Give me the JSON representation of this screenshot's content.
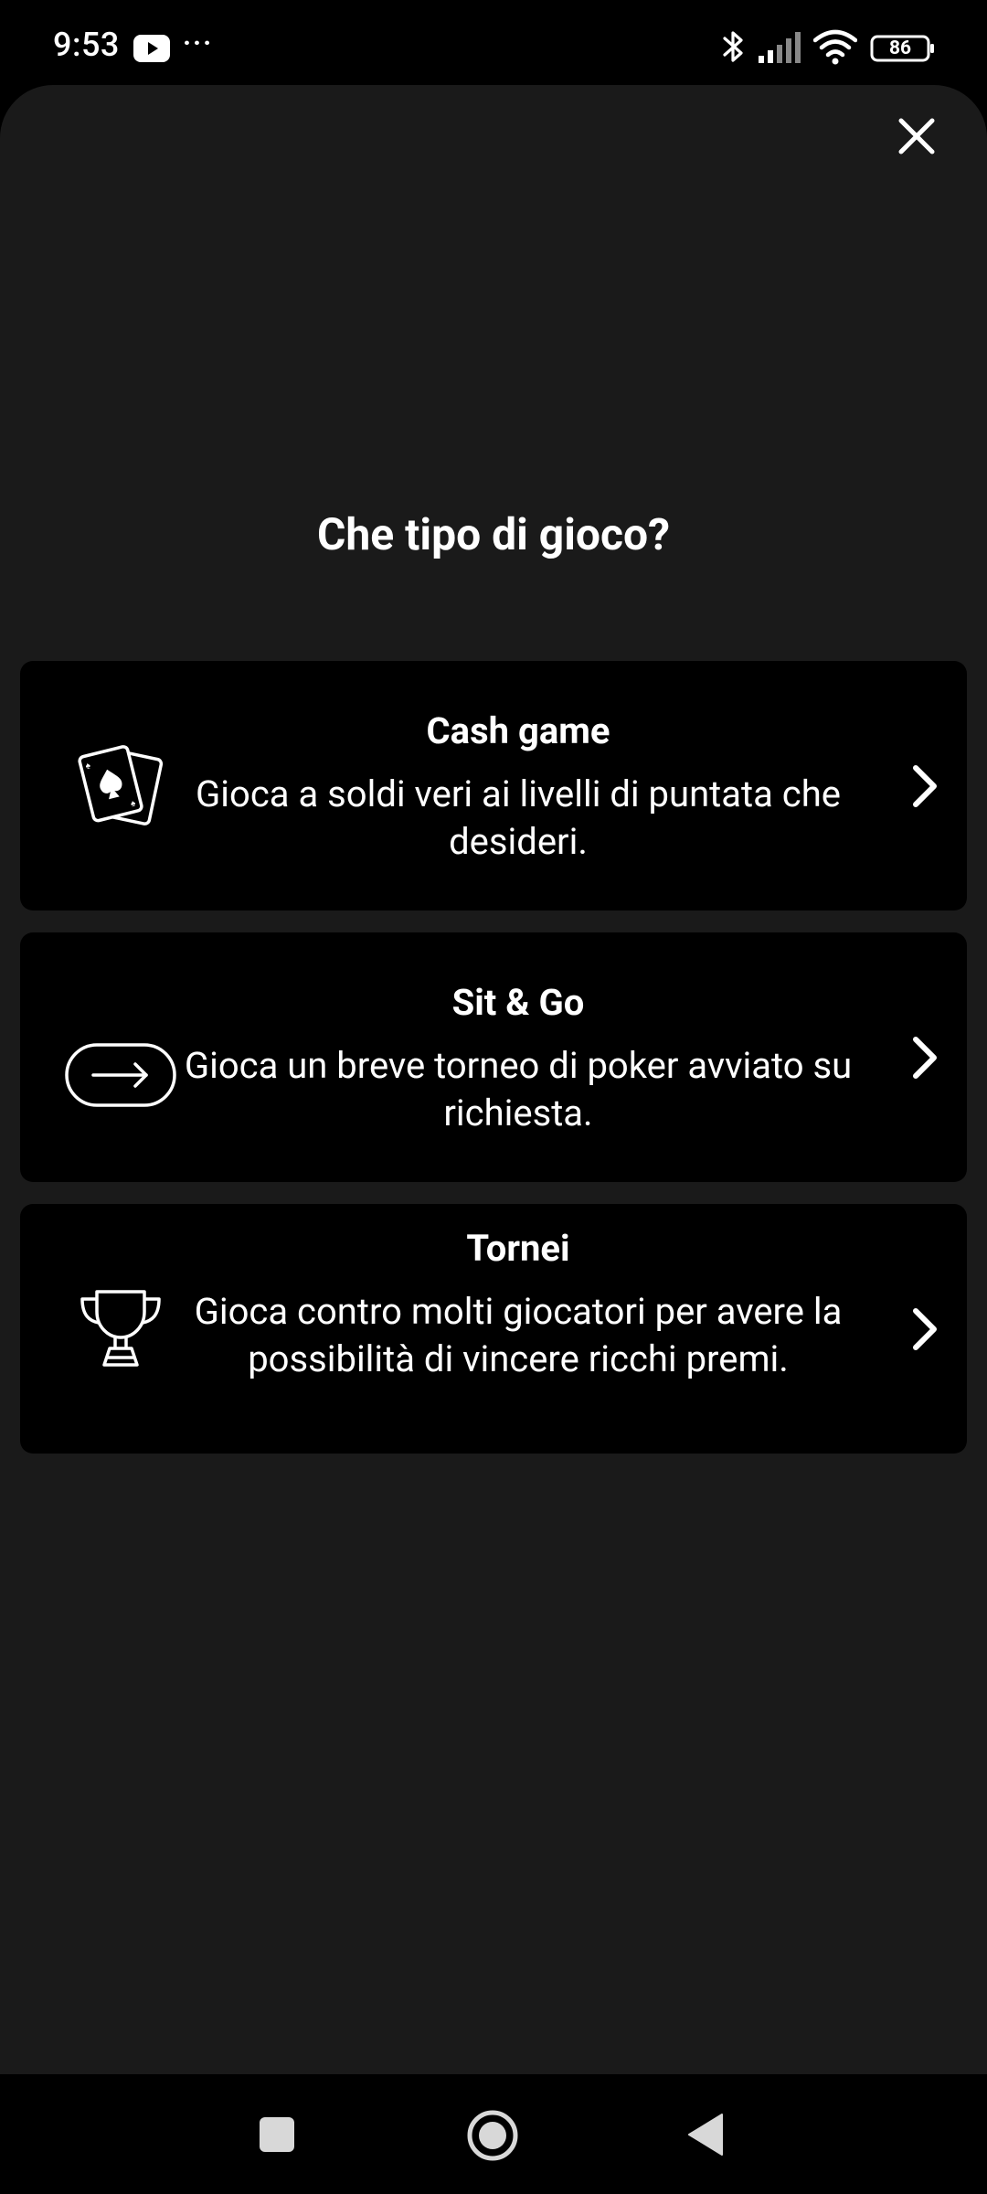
{
  "status_bar": {
    "time": "9:53",
    "more": "···",
    "battery": "86",
    "icons": [
      "youtube-icon",
      "bluetooth-icon",
      "signal-icon",
      "wifi-icon",
      "battery-icon"
    ]
  },
  "sheet": {
    "close_icon": "close-icon",
    "title": "Che tipo di gioco?",
    "options": [
      {
        "title": "Cash game",
        "description": "Gioca a soldi veri ai livelli di puntata che desideri.",
        "icon": "playing-cards-icon"
      },
      {
        "title": "Sit & Go",
        "description": "Gioca un breve torneo di poker avviato su richiesta.",
        "icon": "arrow-right-pill-icon"
      },
      {
        "title": "Tornei",
        "description": "Gioca contro molti giocatori per avere la possibilità di vincere ricchi premi.",
        "icon": "trophy-icon"
      }
    ]
  },
  "nav_bar": {
    "buttons": [
      "recent-apps-button",
      "home-button",
      "back-button"
    ]
  },
  "colors": {
    "background": "#000000",
    "sheet": "#1a1a1a",
    "card": "#000000",
    "text": "#ffffff"
  }
}
